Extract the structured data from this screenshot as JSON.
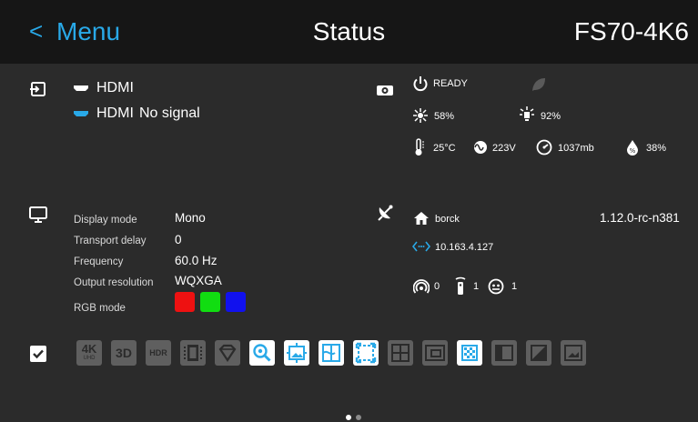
{
  "header": {
    "back_label": "<",
    "menu_label": "Menu",
    "title": "Status",
    "device_name": "FS70-4K6"
  },
  "source": {
    "input_name": "HDMI",
    "signal_name": "HDMI",
    "signal_status": "No signal"
  },
  "projector": {
    "state": "READY",
    "laser_power": "58%",
    "light_output": "92%",
    "temperature": "25°C",
    "voltage": "223V",
    "pressure": "1037mb",
    "humidity": "38%"
  },
  "display": {
    "rows": [
      {
        "label": "Display mode",
        "value": "Mono"
      },
      {
        "label": "Transport delay",
        "value": "0"
      },
      {
        "label": "Frequency",
        "value": "60.0 Hz"
      },
      {
        "label": "Output resolution",
        "value": "WQXGA"
      },
      {
        "label": "RGB mode",
        "value": ""
      }
    ],
    "rgb_colors": [
      "#ee1111",
      "#11dd11",
      "#1111ee"
    ]
  },
  "network": {
    "hostname": "borck",
    "version": "1.12.0-rc-n381",
    "ip_address": "10.163.4.127",
    "wireless_count": "0",
    "remote_count": "1",
    "sensor_count": "1"
  },
  "features": {
    "items": [
      {
        "name": "4k",
        "text": "4K",
        "sub": "UHD",
        "active": false
      },
      {
        "name": "3d",
        "text": "3D",
        "active": false
      },
      {
        "name": "hdr",
        "text": "HDR",
        "active": false
      },
      {
        "name": "film",
        "active": false
      },
      {
        "name": "diamond",
        "active": false
      },
      {
        "name": "zoom",
        "active": true
      },
      {
        "name": "image-fit",
        "active": true
      },
      {
        "name": "warp",
        "active": true
      },
      {
        "name": "blend",
        "active": true
      },
      {
        "name": "grid",
        "active": false
      },
      {
        "name": "pip",
        "active": false
      },
      {
        "name": "pattern",
        "active": true
      },
      {
        "name": "side-by-side",
        "active": false
      },
      {
        "name": "diagonal",
        "active": false
      },
      {
        "name": "picture",
        "active": false
      }
    ]
  },
  "colors": {
    "accent": "#29a9e8",
    "header_bg": "#161616",
    "body_bg": "#2b2b2b"
  },
  "pagination": {
    "pages": 2,
    "current": 1
  }
}
